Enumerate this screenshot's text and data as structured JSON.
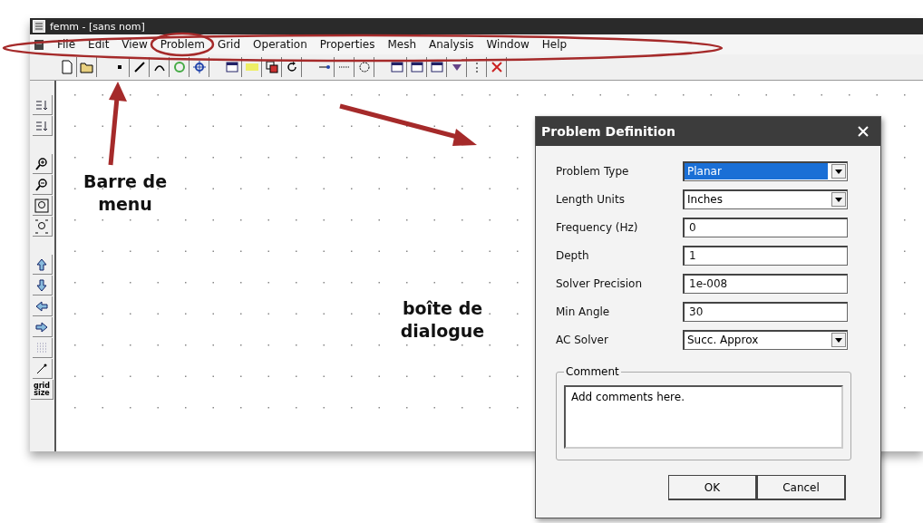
{
  "window": {
    "title": "femm - [sans nom]"
  },
  "menu": [
    "File",
    "Edit",
    "View",
    "Problem",
    "Grid",
    "Operation",
    "Properties",
    "Mesh",
    "Analysis",
    "Window",
    "Help"
  ],
  "left_toolbar": {
    "grid_size_label": "grid size"
  },
  "dialog": {
    "title": "Problem Definition",
    "fields": [
      {
        "label": "Problem Type",
        "kind": "select",
        "value": "Planar",
        "highlighted": true
      },
      {
        "label": "Length Units",
        "kind": "select",
        "value": "Inches",
        "highlighted": false
      },
      {
        "label": "Frequency (Hz)",
        "kind": "text",
        "value": "0",
        "highlighted": false
      },
      {
        "label": "Depth",
        "kind": "text",
        "value": "1",
        "highlighted": false
      },
      {
        "label": "Solver Precision",
        "kind": "text",
        "value": "1e-008",
        "highlighted": false
      },
      {
        "label": "Min Angle",
        "kind": "text",
        "value": "30",
        "highlighted": false
      },
      {
        "label": "AC Solver",
        "kind": "select",
        "value": "Succ. Approx",
        "highlighted": false
      }
    ],
    "comment": {
      "legend": "Comment",
      "value": "Add comments here."
    },
    "buttons": [
      "OK",
      "Cancel"
    ]
  },
  "annotations": [
    "Barre de menu",
    "boîte de dialogue"
  ]
}
